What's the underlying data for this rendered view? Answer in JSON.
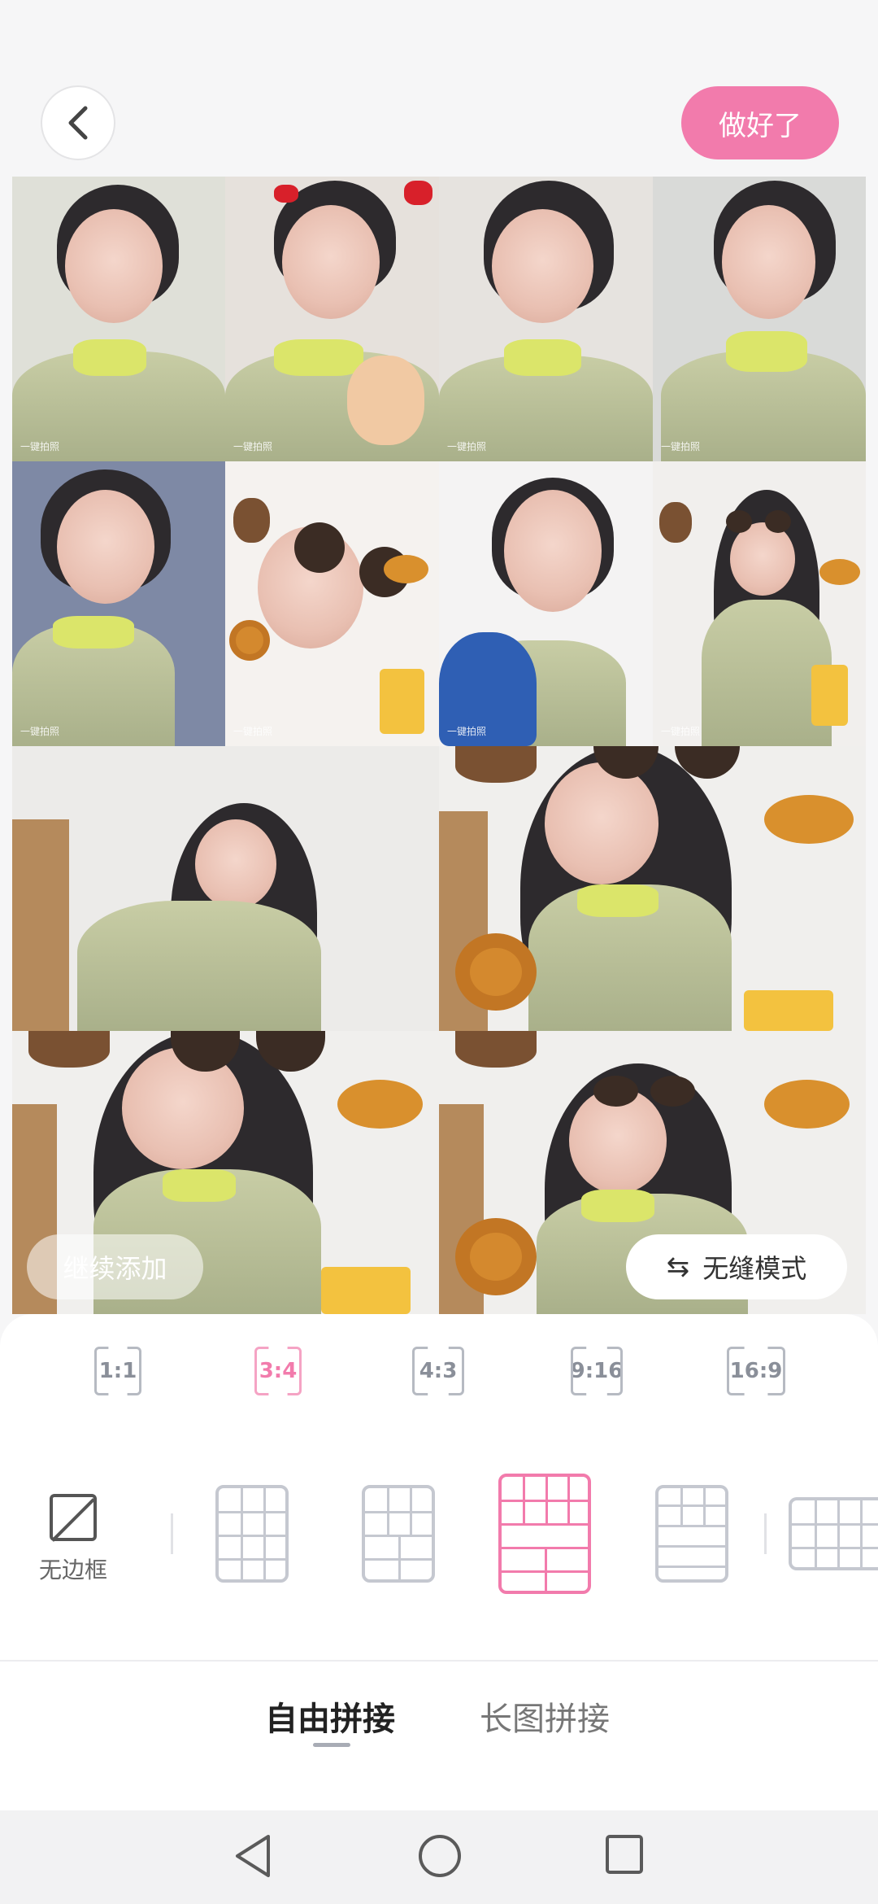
{
  "header": {
    "back_icon": "chevron-left-icon",
    "done_label": "做好了",
    "accent_color": "#f27bac"
  },
  "collage": {
    "watermark": "一键拍照",
    "tiles_count": 14
  },
  "overlay": {
    "add_more_label": "继续添加",
    "seamless_label": "无缝模式",
    "seamless_icon": "swap-arrows-icon"
  },
  "ratios": [
    {
      "label": "1:1"
    },
    {
      "label": "3:4"
    },
    {
      "label": "4:3"
    },
    {
      "label": "9:16"
    },
    {
      "label": "16:9"
    }
  ],
  "selected_ratio": "3:4",
  "layouts": {
    "no_border_label": "无边框",
    "selected_index": 2
  },
  "mode_tabs": [
    {
      "label": "自由拼接"
    },
    {
      "label": "长图拼接"
    }
  ],
  "system_nav": {
    "back": "triangle-back-icon",
    "home": "circle-home-icon",
    "recent": "square-recent-icon"
  }
}
